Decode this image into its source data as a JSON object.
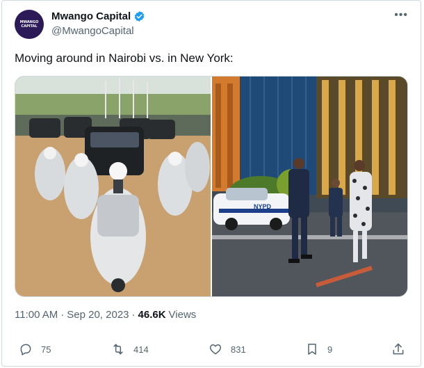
{
  "author": {
    "name": "Mwango Capital",
    "handle": "@MwangoCapital",
    "avatar_text": "MWANGO CAPITAL",
    "verified_color": "#1d9bf0"
  },
  "tweet": {
    "text": "Moving around in Nairobi vs. in New York:"
  },
  "media": [
    {
      "icon": "motorcade-photo"
    },
    {
      "icon": "new-york-street-photo",
      "sign": "NYPD"
    }
  ],
  "meta": {
    "time": "11:00 AM",
    "separator": "·",
    "date": "Sep 20, 2023",
    "views_count": "46.6K",
    "views_label": "Views"
  },
  "actions": {
    "replies": "75",
    "retweets": "414",
    "likes": "831",
    "bookmarks": "9"
  }
}
